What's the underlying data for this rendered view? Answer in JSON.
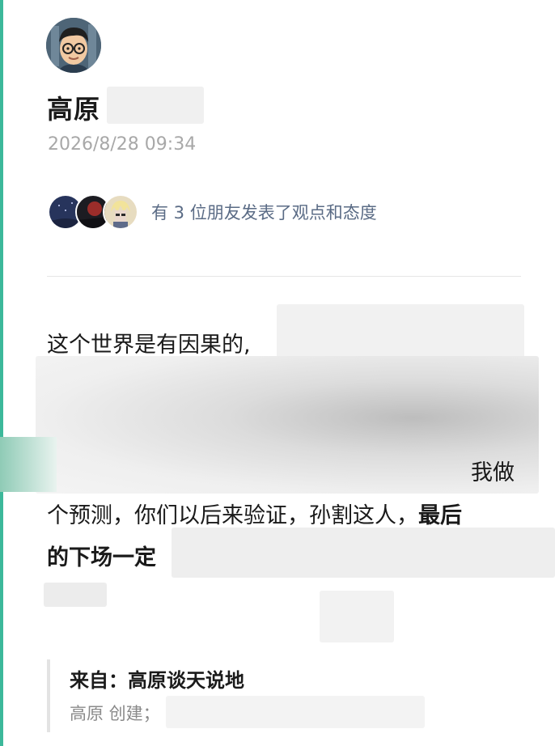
{
  "author": {
    "name": "高原",
    "avatar_icon": "cartoon-man-glasses-avatar"
  },
  "post": {
    "timestamp": "2026/8/28 09:34",
    "friends_text": "有 3 位朋友发表了观点和态度",
    "friend_avatars": [
      "night-sky-avatar",
      "red-sky-avatar",
      "cartoon-character-avatar"
    ],
    "lines": {
      "line1": "这个世界是有因果的,",
      "line2_tail": "我做",
      "line3_regular": "个预测，你们以后来验证，孙割这人，",
      "line3_bold": "最后",
      "line4_bold": "的下场一定"
    }
  },
  "source": {
    "label": "来自：高原谈天说地",
    "creator": "高原 创建；"
  },
  "colors": {
    "accent": "#3cb89a",
    "friends_text": "#5a6b85",
    "timestamp": "#a8a8a8"
  }
}
